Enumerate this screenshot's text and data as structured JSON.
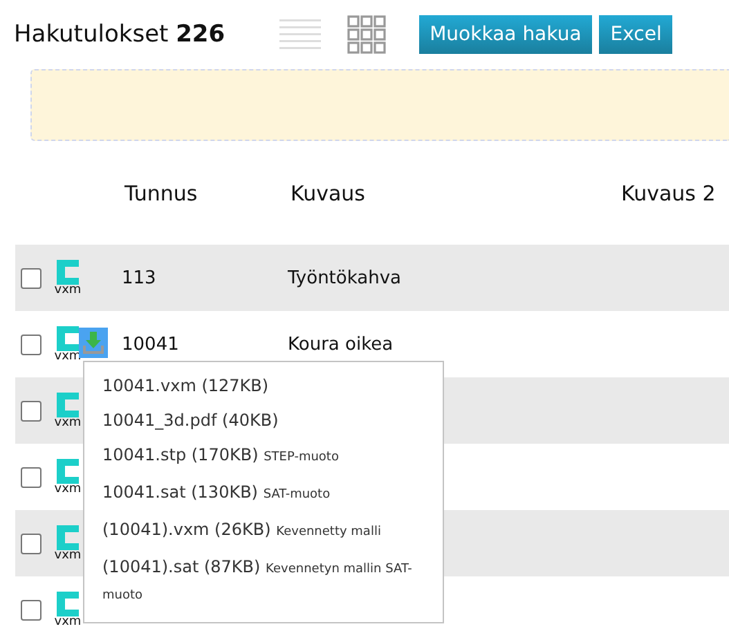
{
  "header": {
    "title": "Hakutulokset",
    "count": "226",
    "buttons": [
      "Muokkaa hakua",
      "Excel"
    ]
  },
  "table": {
    "columns": [
      "Tunnus",
      "Kuvaus",
      "Kuvaus 2"
    ],
    "rows": [
      {
        "checked": false,
        "file_type": "vxm",
        "code": "113",
        "description": "Työntökahva",
        "menu_open": false
      },
      {
        "checked": false,
        "file_type": "vxm",
        "code": "10041",
        "description": "Koura oikea",
        "menu_open": true
      },
      {
        "checked": false,
        "file_type": "vxm",
        "menu_open": false
      },
      {
        "checked": false,
        "file_type": "vxm",
        "menu_open": false
      },
      {
        "checked": false,
        "file_type": "vxm",
        "menu_open": false
      },
      {
        "checked": false,
        "file_type": "vxm",
        "menu_open": false
      }
    ]
  },
  "download_menu": [
    {
      "file": "10041.vxm (127KB)"
    },
    {
      "file": "10041_3d.pdf (40KB)"
    },
    {
      "file": "10041.stp (170KB)",
      "note": "STEP-muoto"
    },
    {
      "file": "10041.sat (130KB)",
      "note": "SAT-muoto"
    },
    {
      "file": "(10041).vxm (26KB)",
      "note": "Kevennetty malli"
    },
    {
      "file": "(10041).sat (87KB)",
      "note": "Kevennetyn mallin SAT-muoto"
    }
  ]
}
